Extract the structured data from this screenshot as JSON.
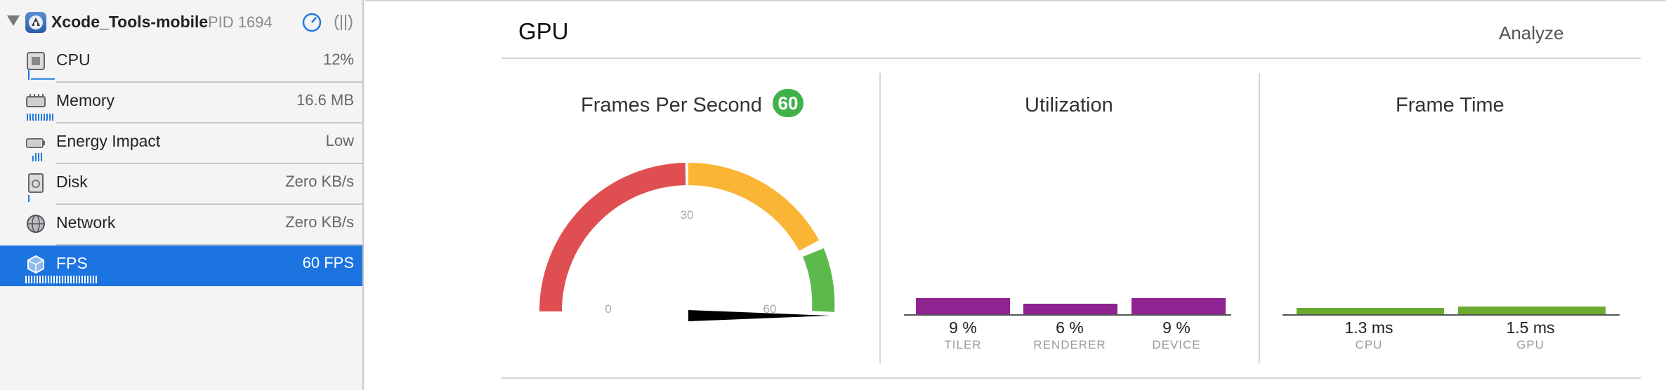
{
  "sidebar": {
    "process": {
      "name": "Xcode_Tools-mobile",
      "pid": "PID 1694"
    },
    "gauges": [
      {
        "label": "CPU",
        "value": "12%"
      },
      {
        "label": "Memory",
        "value": "16.6 MB"
      },
      {
        "label": "Energy Impact",
        "value": "Low"
      },
      {
        "label": "Disk",
        "value": "Zero KB/s"
      },
      {
        "label": "Network",
        "value": "Zero KB/s"
      },
      {
        "label": "FPS",
        "value": "60 FPS",
        "selected": true
      }
    ]
  },
  "main": {
    "title": "GPU",
    "analyze_label": "Analyze",
    "fps_panel": {
      "title": "Frames Per Second",
      "badge": "60",
      "gauge_min_label": "0",
      "gauge_mid_label": "30",
      "gauge_max_label": "60",
      "value": 60,
      "colors": {
        "red": "#df4f52",
        "yellow": "#fbb534",
        "green": "#5cb94c"
      }
    },
    "utilization": {
      "title": "Utilization",
      "bars": [
        {
          "category": "TILER",
          "label": "9 %",
          "value": 9
        },
        {
          "category": "RENDERER",
          "label": "6 %",
          "value": 6
        },
        {
          "category": "DEVICE",
          "label": "9 %",
          "value": 9
        }
      ],
      "color": "#8e2391"
    },
    "frame_time": {
      "title": "Frame Time",
      "bars": [
        {
          "category": "CPU",
          "label": "1.3 ms",
          "value": 1.3
        },
        {
          "category": "GPU",
          "label": "1.5 ms",
          "value": 1.5
        }
      ],
      "color": "#6aaa2e"
    }
  },
  "colors": {
    "selection": "#1c74e0",
    "accent": "#1f7ae0"
  }
}
